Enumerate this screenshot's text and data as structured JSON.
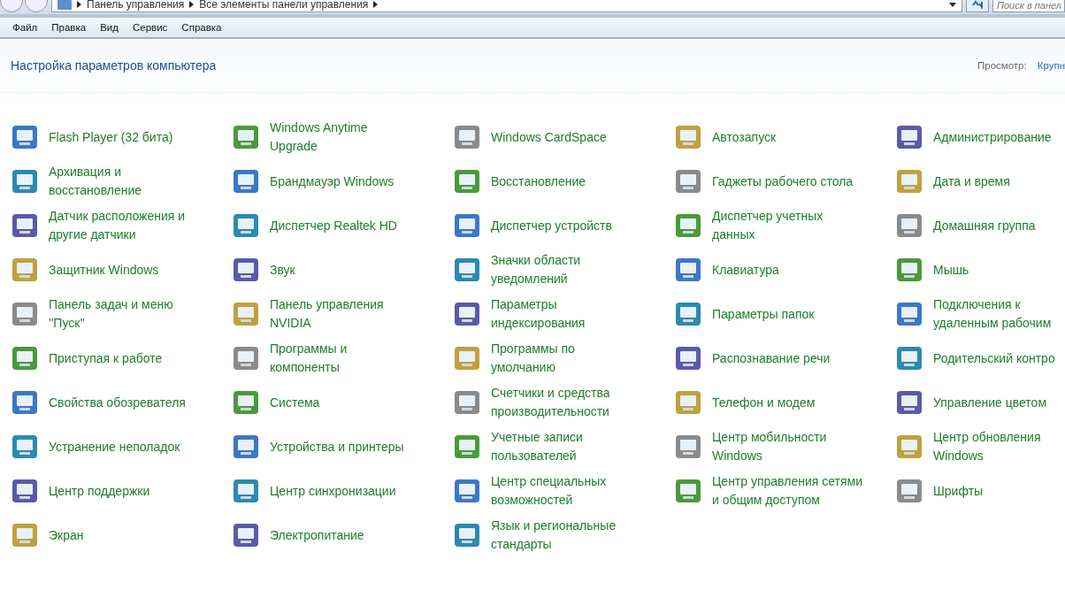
{
  "address_bar": {
    "breadcrumbs": [
      "Панель управления",
      "Все элементы панели управления"
    ],
    "search": {
      "placeholder": "Поиск в панел"
    }
  },
  "menu": [
    "Файл",
    "Правка",
    "Вид",
    "Сервис",
    "Справка"
  ],
  "header": {
    "title": "Настройка параметров компьютера",
    "view_label": "Просмотр:",
    "view_value": "Крупн"
  },
  "items": [
    {
      "label": "Flash Player (32 бита)"
    },
    {
      "label": "Windows Anytime\nUpgrade"
    },
    {
      "label": "Windows CardSpace"
    },
    {
      "label": "Автозапуск"
    },
    {
      "label": "Администрирование"
    },
    {
      "label": "Архивация и\nвосстановление"
    },
    {
      "label": "Брандмауэр Windows"
    },
    {
      "label": "Восстановление"
    },
    {
      "label": "Гаджеты рабочего стола"
    },
    {
      "label": "Дата и время"
    },
    {
      "label": "Датчик расположения и\nдругие датчики"
    },
    {
      "label": "Диспетчер Realtek HD"
    },
    {
      "label": "Диспетчер устройств"
    },
    {
      "label": "Диспетчер учетных\nданных"
    },
    {
      "label": "Домашняя группа"
    },
    {
      "label": "Защитник Windows"
    },
    {
      "label": "Звук"
    },
    {
      "label": "Значки области\nуведомлений"
    },
    {
      "label": "Клавиатура"
    },
    {
      "label": "Мышь"
    },
    {
      "label": "Панель задач и меню\n''Пуск''"
    },
    {
      "label": "Панель управления\nNVIDIA"
    },
    {
      "label": "Параметры\nиндексирования"
    },
    {
      "label": "Параметры папок"
    },
    {
      "label": "Подключения к\nудаленным рабочим"
    },
    {
      "label": "Приступая к работе"
    },
    {
      "label": "Программы и\nкомпоненты"
    },
    {
      "label": "Программы по\nумолчанию"
    },
    {
      "label": "Распознавание речи"
    },
    {
      "label": "Родительский контро"
    },
    {
      "label": "Свойства обозревателя"
    },
    {
      "label": "Система"
    },
    {
      "label": "Счетчики и средства\nпроизводительности"
    },
    {
      "label": "Телефон и модем"
    },
    {
      "label": "Управление цветом"
    },
    {
      "label": "Устранение неполадок"
    },
    {
      "label": "Устройства и принтеры"
    },
    {
      "label": "Учетные записи\nпользователей"
    },
    {
      "label": "Центр мобильности\nWindows"
    },
    {
      "label": "Центр обновления\nWindows"
    },
    {
      "label": "Центр поддержки"
    },
    {
      "label": "Центр синхронизации"
    },
    {
      "label": "Центр специальных\nвозможностей"
    },
    {
      "label": "Центр управления сетями\nи общим доступом"
    },
    {
      "label": "Шрифты"
    },
    {
      "label": "Экран"
    },
    {
      "label": "Электропитание"
    },
    {
      "label": "Язык и региональные\nстандарты"
    }
  ]
}
